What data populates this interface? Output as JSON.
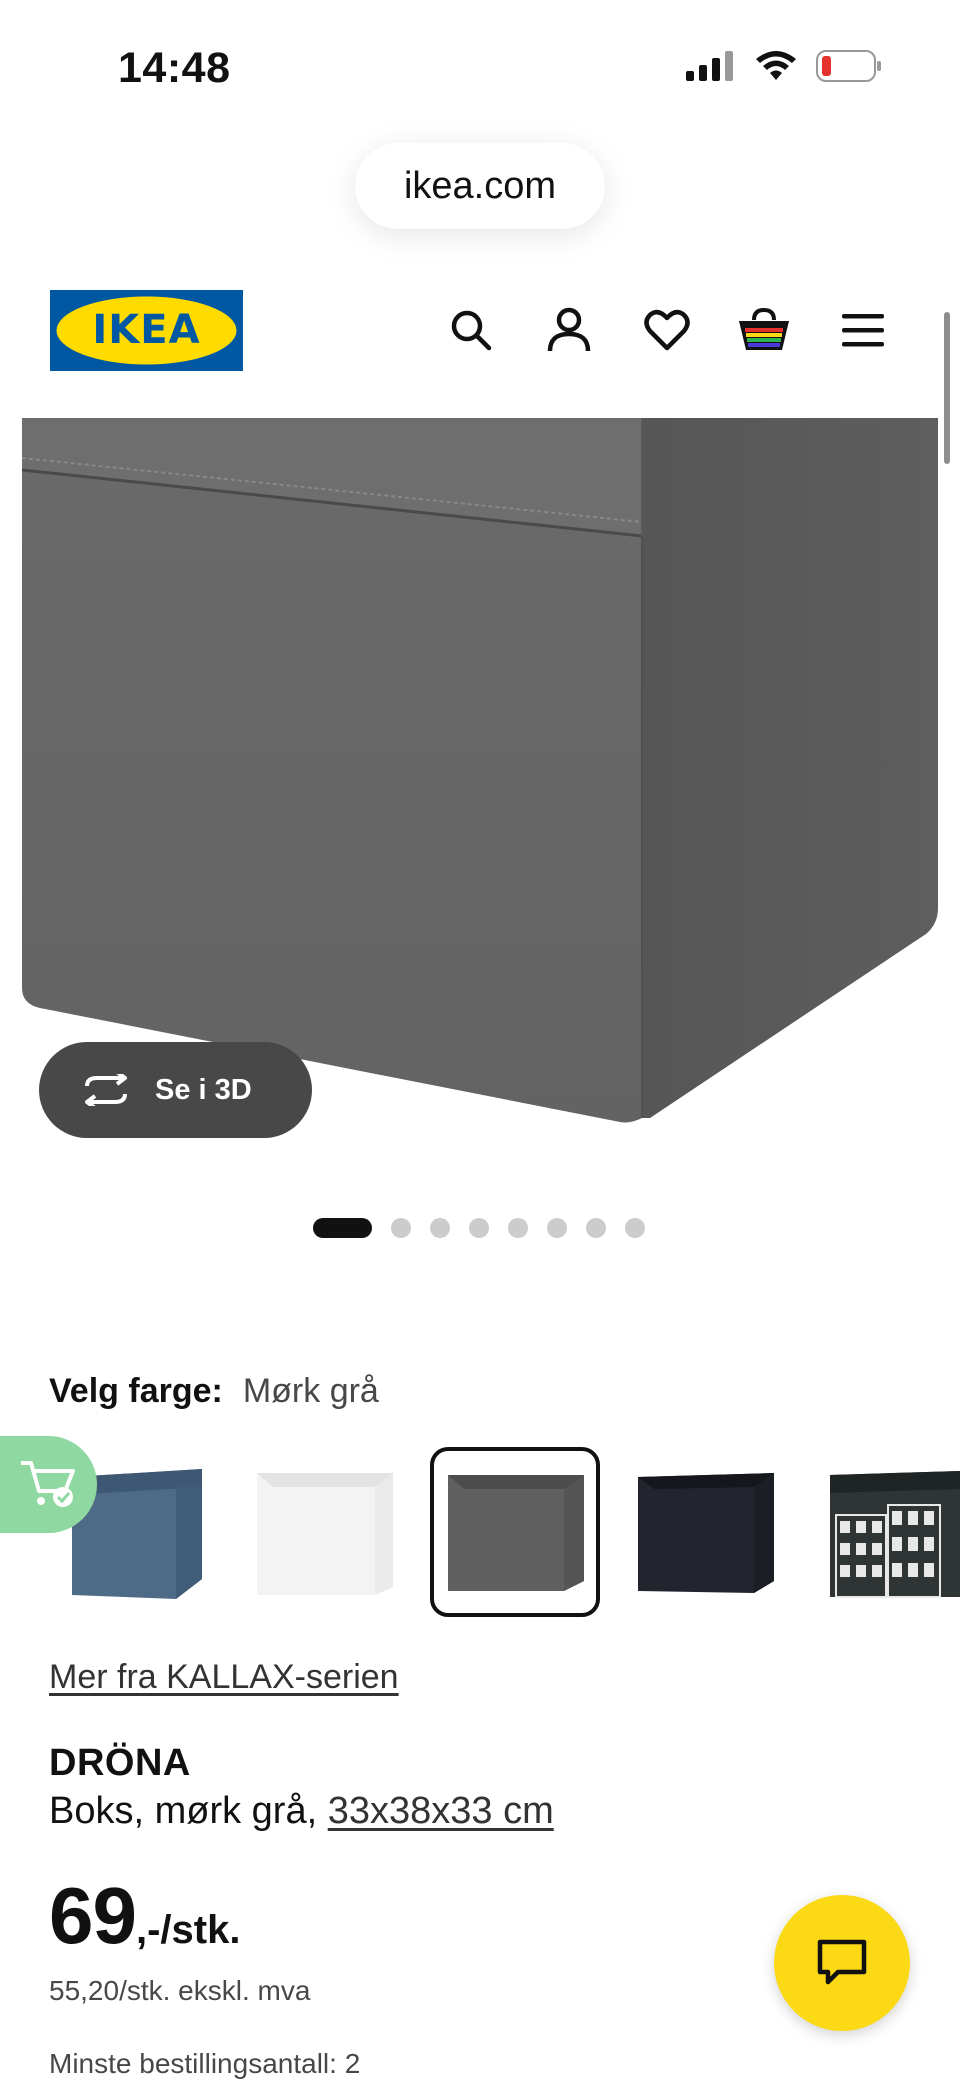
{
  "status_bar": {
    "time": "14:48",
    "battery_color": "#e5322d"
  },
  "browser": {
    "url": "ikea.com"
  },
  "header": {
    "logo_text": "IKEA",
    "brand_colors": {
      "blue": "#0058a3",
      "yellow": "#ffdb00"
    },
    "icons": [
      "search-icon",
      "account-icon",
      "heart-icon",
      "basket-icon",
      "menu-icon"
    ]
  },
  "gallery": {
    "view_3d_label": "Se i 3D",
    "image_count": 8,
    "active_index": 0
  },
  "color_picker": {
    "label": "Velg farge:",
    "selected": "Mørk grå",
    "swatches": [
      {
        "name": "blue",
        "color": "#4d6a87"
      },
      {
        "name": "white",
        "color": "#f2f2f2"
      },
      {
        "name": "dark-grey",
        "color": "#5f5f5f"
      },
      {
        "name": "black",
        "color": "#22252e"
      },
      {
        "name": "patterned",
        "color": "#2f3535"
      }
    ]
  },
  "product": {
    "series_link": "Mer fra KALLAX-serien",
    "name": "DRÖNA",
    "description_prefix": "Boks, mørk grå, ",
    "dimensions": "33x38x33 cm",
    "price_integer": "69",
    "price_suffix": ",-/stk.",
    "price_ex_vat": "55,20/stk. ekskl. mva",
    "min_order": "Minste bestillingsantall: 2"
  },
  "colors": {
    "chat_button": "#fbd914",
    "cart_tab": "#8fd8a1",
    "pill_dark": "#484848"
  }
}
